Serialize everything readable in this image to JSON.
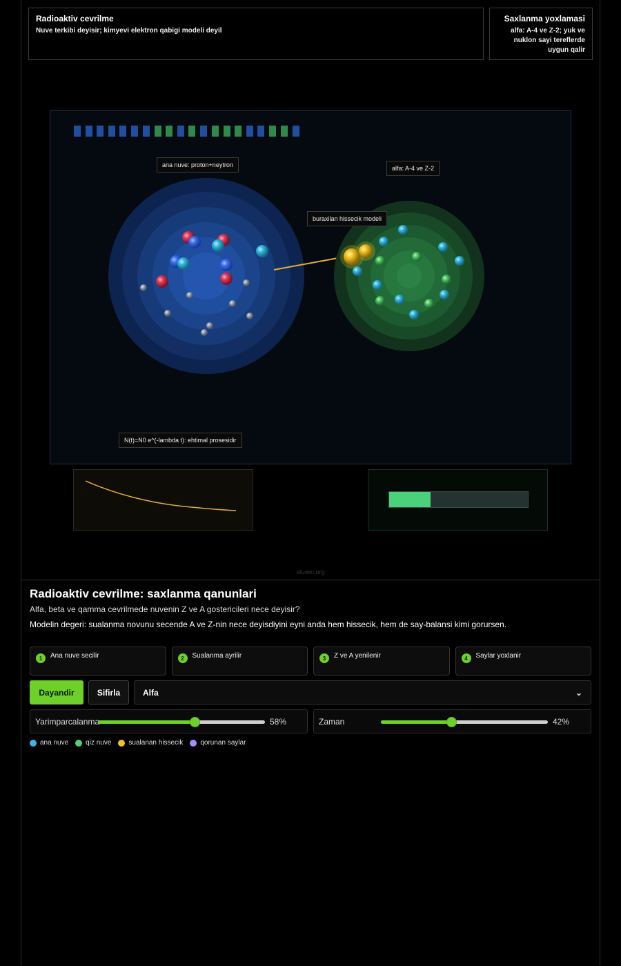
{
  "header": {
    "left_title": "Radioaktiv cevrilme",
    "left_subtitle": "Nuve terkibi deyisir; kimyevi elektron qabigi modeli deyil",
    "right_title": "Saxlanma yoxlamasi",
    "right_subtitle": "alfa: A-4 ve Z-2; yuk ve nuklon sayi tereflerde uygun qalir"
  },
  "simulation": {
    "label_parent": "ana nuve: proton+neytron",
    "label_daughter": "alfa: A-4 ve Z-2",
    "label_emitted": "buraxilan hissecik modeli",
    "label_decay_law": "N(t)=N0 e^(-lambda t): ehtimal prosesidir",
    "counter_colors": [
      "#1e4fa0",
      "#2e8a4a"
    ],
    "progress_fraction": 0.3
  },
  "watermark": "stuwin.org",
  "content": {
    "title": "Radioaktiv cevrilme: saxlanma qanunlari",
    "question": "Alfa, beta ve qamma cevrilmede nuvenin Z ve A gostericileri nece deyisir?",
    "model_value": "Modelin degeri: sualanma novunu secende A ve Z-nin nece deyisdiyini eyni anda hem hissecik, hem de say-balansi kimi gorursen."
  },
  "steps": [
    {
      "num": "1",
      "label": "Ana nuve secilir"
    },
    {
      "num": "2",
      "label": "Sualanma ayrilir"
    },
    {
      "num": "3",
      "label": "Z ve A yenilenir"
    },
    {
      "num": "4",
      "label": "Saylar yoxlanir"
    }
  ],
  "controls": {
    "pause_label": "Dayandir",
    "reset_label": "Sifirla",
    "decay_type_selected": "Alfa"
  },
  "sliders": {
    "half_life": {
      "label": "Yarimparcalanma",
      "value": 58,
      "display": "58%"
    },
    "time": {
      "label": "Zaman",
      "value": 42,
      "display": "42%"
    }
  },
  "legend": [
    {
      "label": "ana nuve",
      "color": "#3bb4ea"
    },
    {
      "label": "qiz nuve",
      "color": "#4bd17a"
    },
    {
      "label": "sualanan hissecik",
      "color": "#f0c020"
    },
    {
      "label": "qorunan saylar",
      "color": "#a78bfa"
    }
  ],
  "colors": {
    "accent": "#6fcf2b",
    "parent": "#2a5fcf",
    "daughter": "#2e8a4a",
    "emitted": "#f0c020"
  }
}
